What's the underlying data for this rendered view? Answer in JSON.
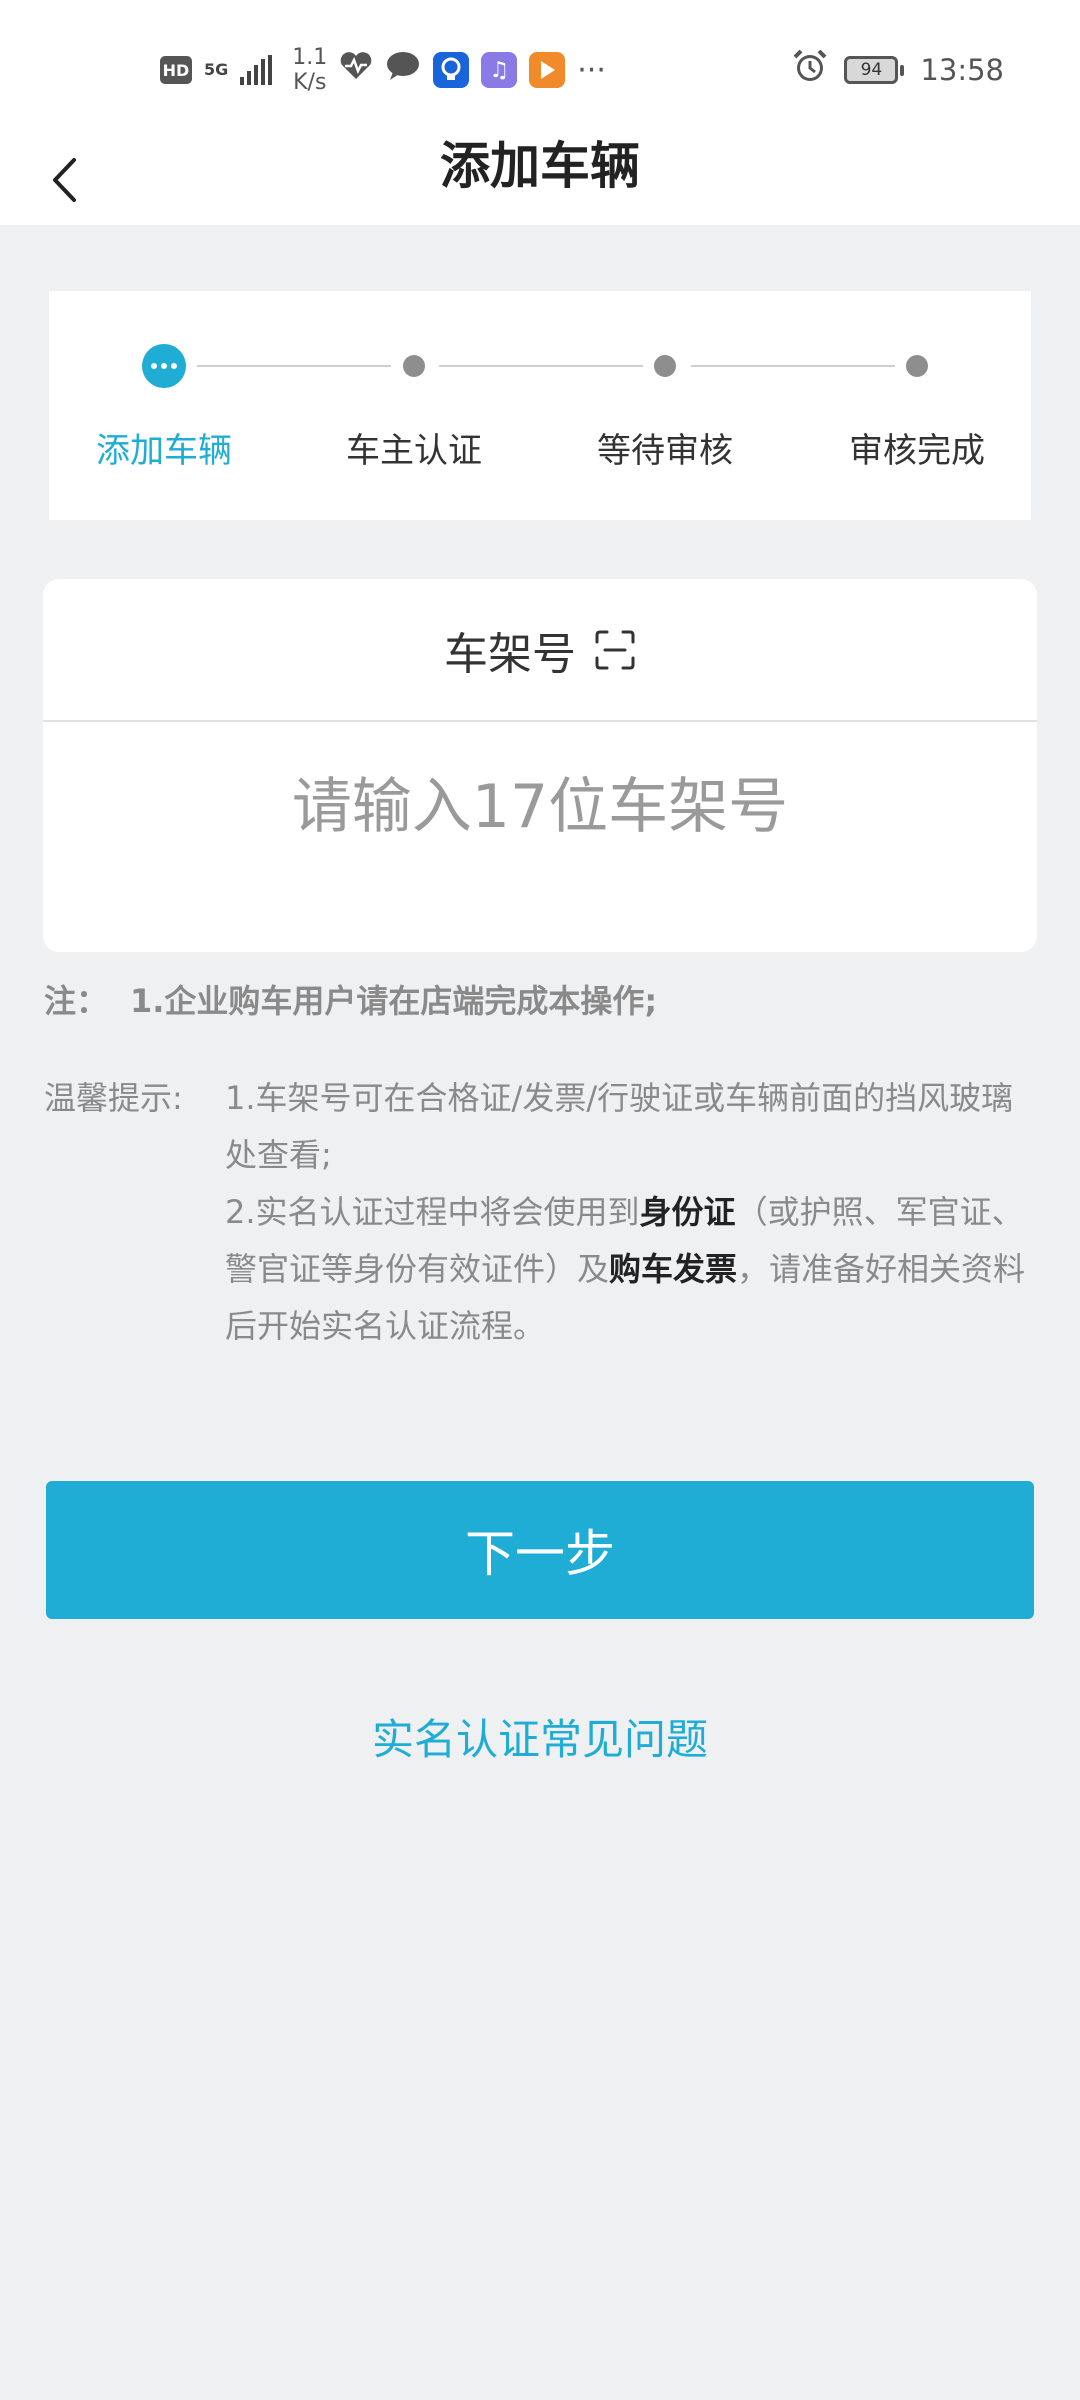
{
  "status_bar": {
    "hd": "HD",
    "network": "5G",
    "speed_value": "1.1",
    "speed_unit": "K/s",
    "more": "···",
    "battery": "94",
    "time": "13:58",
    "app_icons": [
      "heart-rate-icon",
      "chat-bubble-icon",
      "lightbulb-app-icon",
      "music-app-icon",
      "video-app-icon"
    ]
  },
  "header": {
    "title": "添加车辆"
  },
  "steps": [
    {
      "label": "添加车辆",
      "active": true
    },
    {
      "label": "车主认证",
      "active": false
    },
    {
      "label": "等待审核",
      "active": false
    },
    {
      "label": "审核完成",
      "active": false
    }
  ],
  "vin": {
    "title": "车架号",
    "placeholder": "请输入17位车架号",
    "value": ""
  },
  "note": {
    "label": "注：",
    "text": "1.企业购车用户请在店端完成本操作;"
  },
  "tips": {
    "label": "温馨提示:",
    "line1": "1.车架号可在合格证/发票/行驶证或车辆前面的挡风玻璃处查看;",
    "line2_prefix": "2.实名认证过程中将会使用到",
    "line2_bold1": "身份证",
    "line2_mid": "（或护照、军官证、警官证等身份有效证件）及",
    "line2_bold2": "购车发票",
    "line2_suffix": "，请准备好相关资料后开始实名认证流程。"
  },
  "next_button": "下一步",
  "faq_link": "实名认证常见问题",
  "colors": {
    "accent": "#1fadd5",
    "background": "#eff0f2",
    "inactive_dot": "#8e8e8e"
  }
}
